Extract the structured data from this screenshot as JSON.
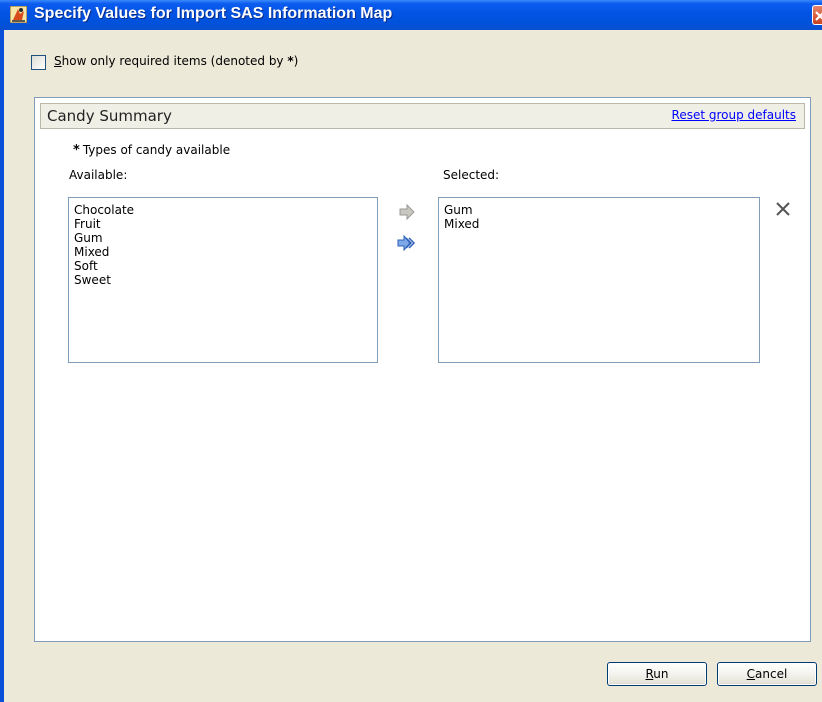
{
  "window": {
    "title": "Specify Values for Import SAS Information Map",
    "title_icon": "sas-wizard-icon",
    "close_icon": "close-icon"
  },
  "filter": {
    "required_only": {
      "checked": false,
      "mnemonic": "S",
      "label_rest": "how only required items (denoted by ",
      "marker": "*",
      "label_end": ")"
    }
  },
  "group": {
    "title": "Candy Summary",
    "reset_link": "Reset group defaults"
  },
  "prompt": {
    "required_marker": "*",
    "label": "Types of candy available",
    "available_label": "Available:",
    "selected_label": "Selected:",
    "available_items": [
      "Chocolate",
      "Fruit",
      "Gum",
      "Mixed",
      "Soft",
      "Sweet"
    ],
    "selected_items": [
      "Gum",
      "Mixed"
    ],
    "move_one_icon": "arrow-right-icon",
    "move_all_icon": "double-arrow-right-icon",
    "remove_icon": "remove-x-icon"
  },
  "buttons": {
    "run": {
      "mnemonic": "R",
      "rest": "un"
    },
    "cancel": {
      "mnemonic": "C",
      "rest": "ancel"
    }
  },
  "colors": {
    "titlebar": "#0253e3",
    "dialog_bg": "#ece9d8",
    "link": "#0000ff",
    "close_button": "#c9421f"
  }
}
